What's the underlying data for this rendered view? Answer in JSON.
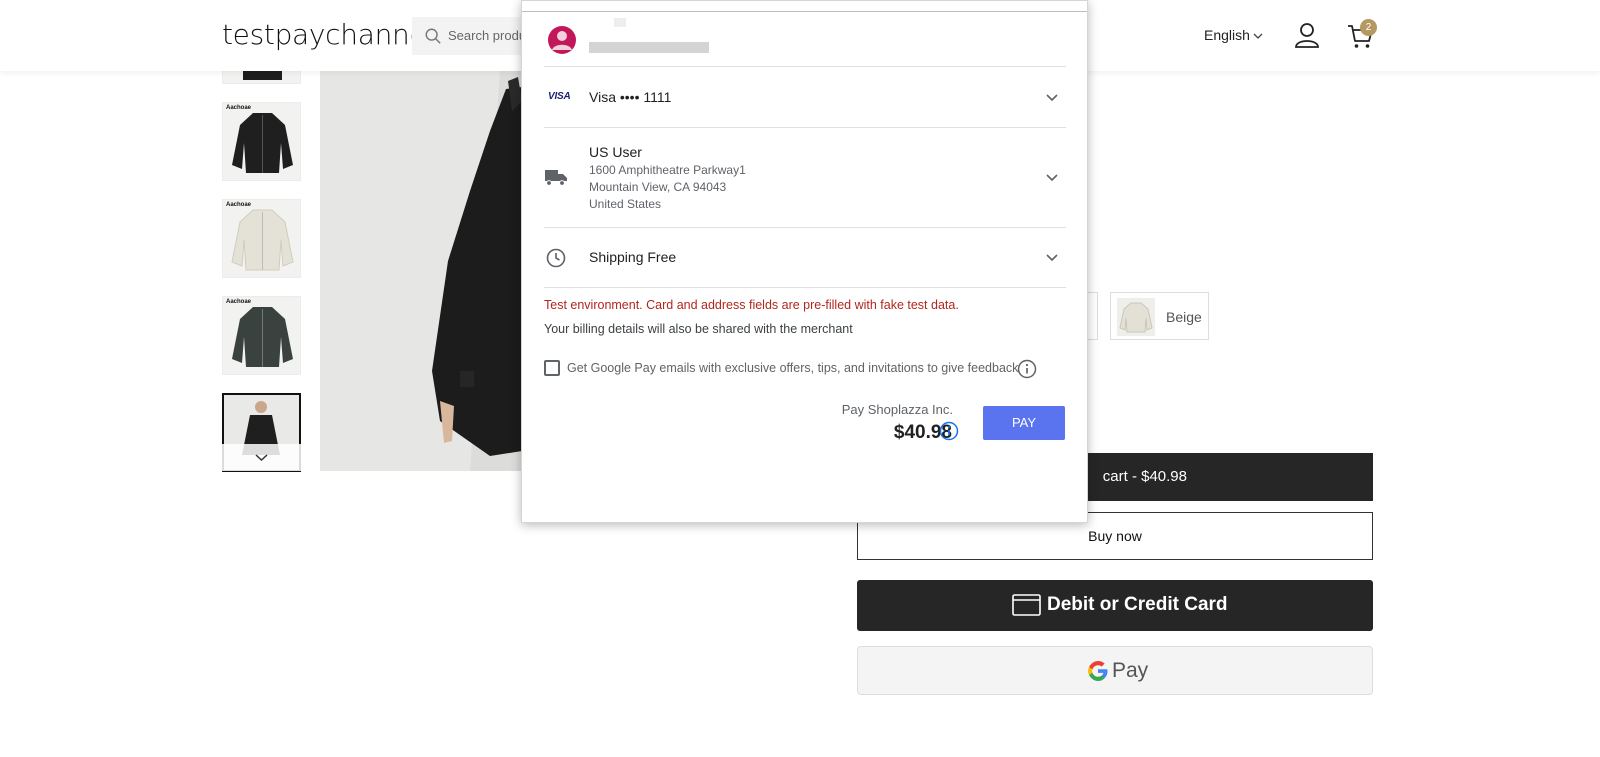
{
  "header": {
    "logo": "testpaychannel",
    "search_placeholder": "Search products",
    "language": "English",
    "cart_count": "2"
  },
  "product": {
    "thumbnail_brand": "Aachoae",
    "variant_option": "Beige",
    "add_to_cart_label": "cart  -  $40.98",
    "buy_now_label": "Buy now",
    "card_button_label": "Debit or Credit Card",
    "gpay_label": "Pay"
  },
  "payment_sheet": {
    "card": "Visa •••• 1111",
    "card_brand": "VISA",
    "address": {
      "name": "US User",
      "line1": "1600 Amphitheatre Parkway1",
      "line2": "Mountain View, CA 94043",
      "country": "United States"
    },
    "shipping": "Shipping Free",
    "test_warning": "Test environment. Card and address fields are pre-filled with fake test data.",
    "billing_note": "Your billing details will also be shared with the merchant",
    "optin_label": "Get Google Pay emails with exclusive offers, tips, and invitations to give feedback",
    "optin_checked": false,
    "pay_to": "Pay Shoplazza Inc.",
    "amount": "$40.98",
    "pay_button": "PAY"
  },
  "colors": {
    "accent": "#5a73ef",
    "warning": "#b3261e",
    "badge": "#b59963",
    "dark_button": "#262626"
  }
}
